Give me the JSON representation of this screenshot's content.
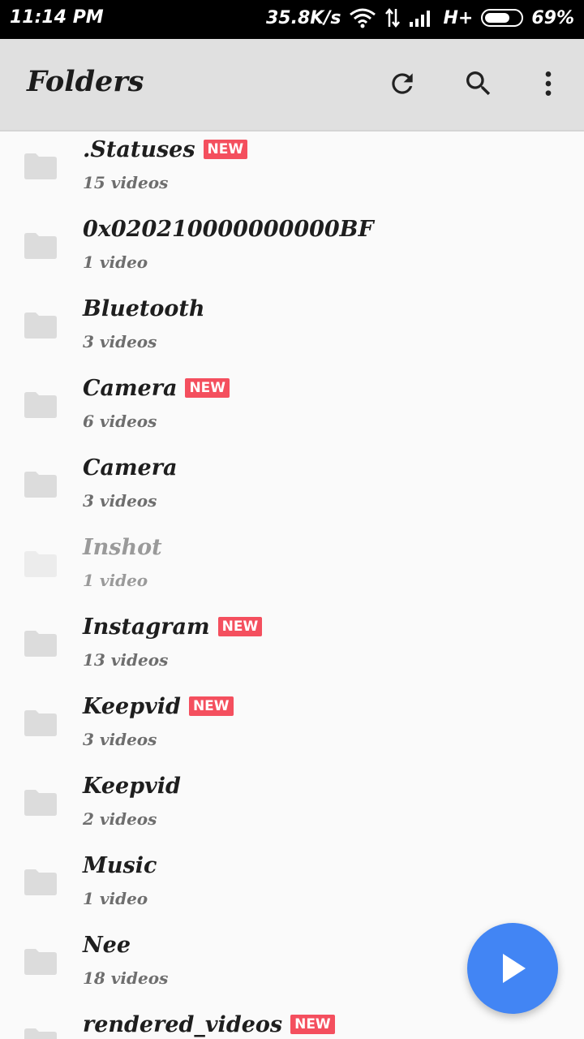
{
  "status_bar": {
    "time": "11:14 PM",
    "net_speed": "35.8K/s",
    "network_type": "H+",
    "battery": "69%"
  },
  "app_bar": {
    "title": "Folders",
    "actions": [
      {
        "icon": "refresh-icon"
      },
      {
        "icon": "search-icon"
      },
      {
        "icon": "more-vert-icon"
      }
    ]
  },
  "folders": [
    {
      "name": ".Statuses",
      "count": "15 videos",
      "badge": "NEW"
    },
    {
      "name": "0x020210000000000BF",
      "count": "1 video",
      "badge": ""
    },
    {
      "name": "Bluetooth",
      "count": "3 videos",
      "badge": ""
    },
    {
      "name": "Camera",
      "count": "6 videos",
      "badge": "NEW"
    },
    {
      "name": "Camera",
      "count": "3 videos",
      "badge": ""
    },
    {
      "name": "Inshot",
      "count": "1 video",
      "badge": ""
    },
    {
      "name": "Instagram",
      "count": "13 videos",
      "badge": "NEW"
    },
    {
      "name": "Keepvid",
      "count": "3 videos",
      "badge": "NEW"
    },
    {
      "name": "Keepvid",
      "count": "2 videos",
      "badge": ""
    },
    {
      "name": "Music",
      "count": "1 video",
      "badge": ""
    },
    {
      "name": "Nee",
      "count": "18 videos",
      "badge": ""
    },
    {
      "name": "rendered_videos",
      "count": "",
      "badge": "NEW"
    }
  ],
  "fab": {
    "icon": "play-icon"
  },
  "colors": {
    "badge": "#f44f5e",
    "fab": "#4285f4",
    "app_bar": "#e0e0e0",
    "folder_icon": "#dcdcdc"
  }
}
